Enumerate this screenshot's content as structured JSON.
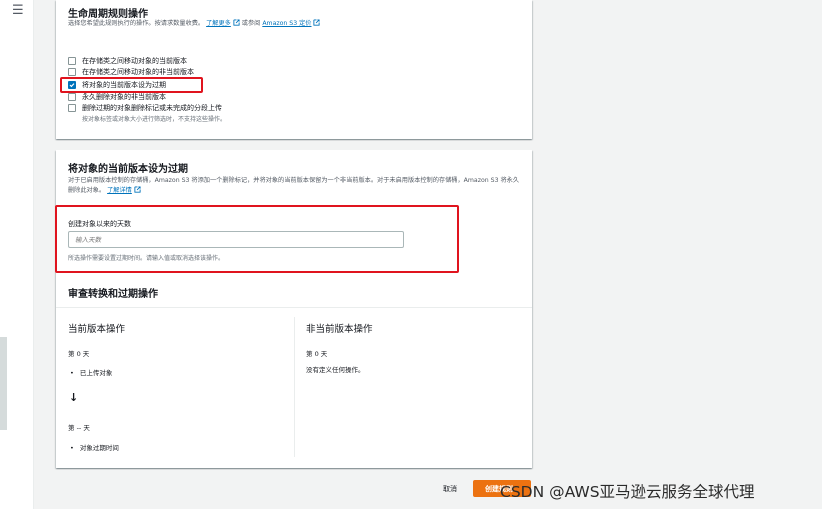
{
  "nav": {
    "menu_icon": "menu-icon"
  },
  "lifecycle": {
    "title": "生命周期规则操作",
    "desc_prefix": "选择您希望此规则执行的操作。按请求数量收费。",
    "learn_more": "了解更多",
    "desc_mid": "或参阅",
    "pricing_link": "Amazon S3 定价",
    "options": [
      {
        "label": "在存储类之间移动对象的当前版本",
        "checked": false
      },
      {
        "label": "在存储类之间移动对象的非当前版本",
        "checked": false
      },
      {
        "label": "将对象的当前版本设为过期",
        "checked": true
      },
      {
        "label": "永久删除对象的非当前版本",
        "checked": false
      },
      {
        "label": "删除过期的对象删除标记或未完成的分段上传",
        "checked": false
      }
    ],
    "options_hint": "按对象标签或对象大小进行筛选时，不支持这些操作。"
  },
  "expire": {
    "title": "将对象的当前版本设为过期",
    "desc": "对于已启用版本控制的存储桶，Amazon S3 将添加一个删除标记，并将对象的当前版本保留为一个非当前版本。对于未启用版本控制的存储桶，Amazon S3 将永久删除此对象。",
    "details_link": "了解详情",
    "field_label": "创建对象以来的天数",
    "field_placeholder": "输入天数",
    "field_hint": "所选操作需要设置过期时间。请输入值或取消选择该操作。"
  },
  "review": {
    "title": "审查转换和过期操作",
    "current": {
      "title": "当前版本操作",
      "day0": "第 0 天",
      "upload": "已上传对象",
      "day_blank": "第 -- 天",
      "expire": "对象过期时间"
    },
    "noncurrent": {
      "title": "非当前版本操作",
      "day0": "第 0 天",
      "none": "没有定义任何操作。"
    }
  },
  "footer": {
    "cancel": "取消",
    "create": "创建规则"
  },
  "watermark": "CSDN @AWS亚马逊云服务全球代理",
  "colors": {
    "accent": "#ec7211",
    "link": "#0073bb",
    "highlight": "#e0141e"
  }
}
